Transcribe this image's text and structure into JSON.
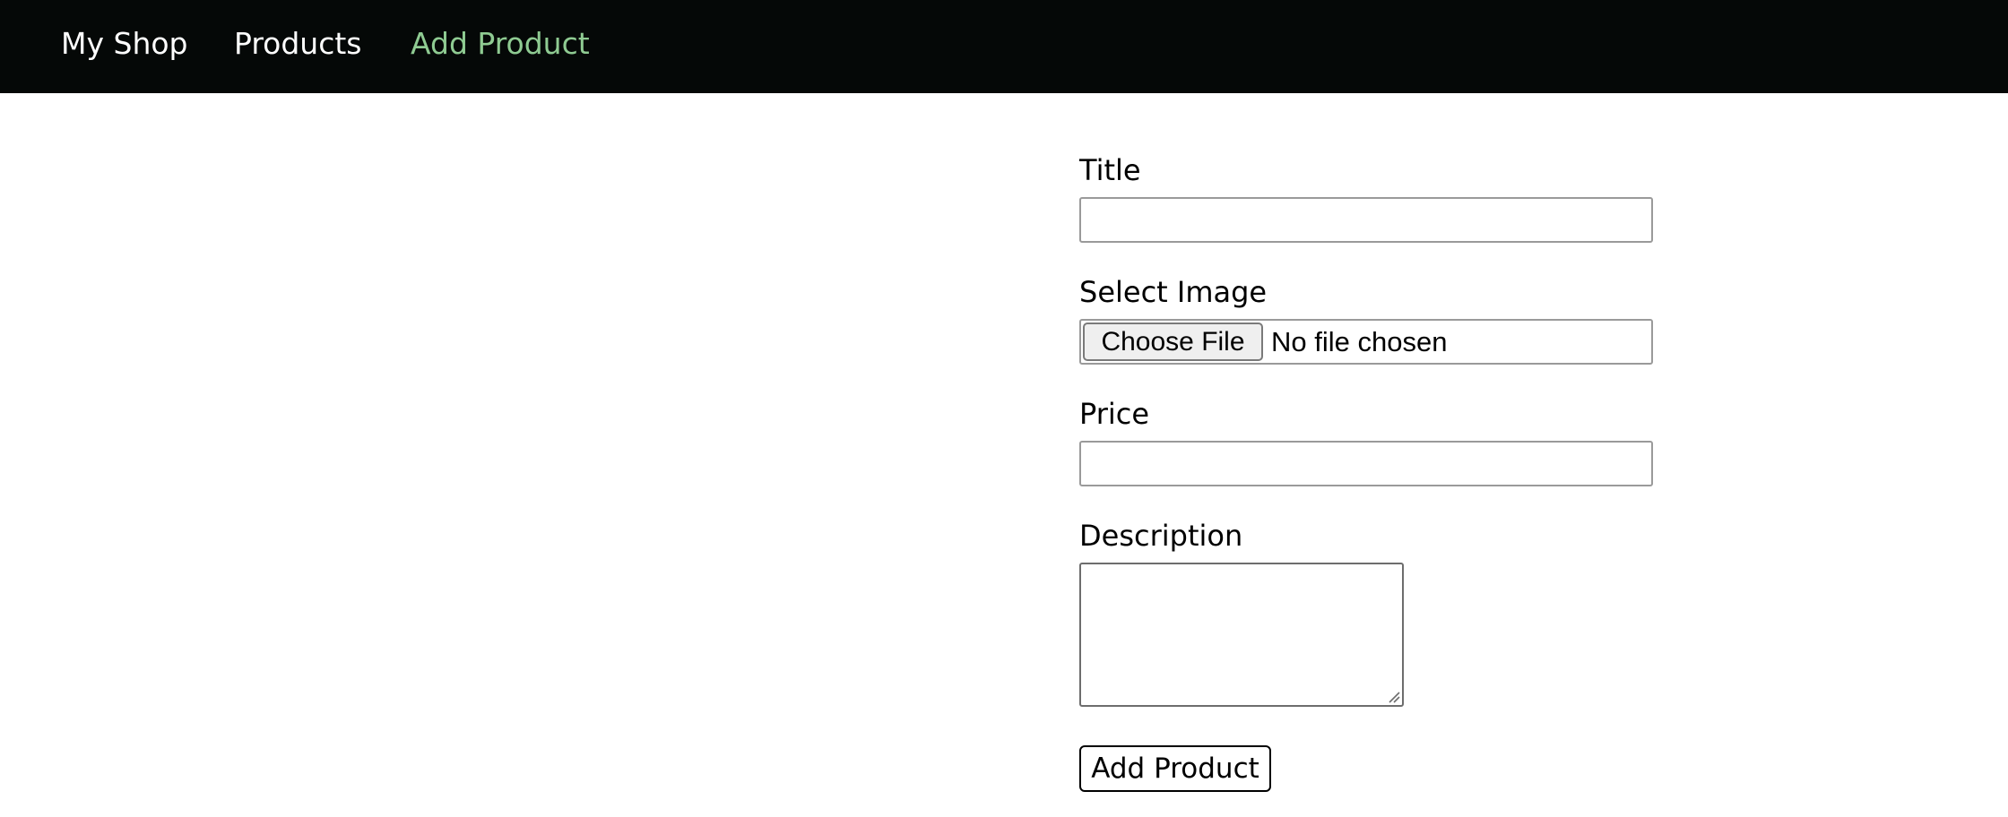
{
  "colors": {
    "nav_background": "#050807",
    "nav_text": "#ffffff",
    "nav_active_text": "#8fcb92"
  },
  "nav": {
    "brand": "My Shop",
    "items": [
      {
        "label": "Products",
        "active": false
      },
      {
        "label": "Add Product",
        "active": true
      }
    ]
  },
  "form": {
    "title": {
      "label": "Title",
      "value": ""
    },
    "image": {
      "label": "Select Image",
      "button_label": "Choose File",
      "status": "No file chosen"
    },
    "price": {
      "label": "Price",
      "value": ""
    },
    "description": {
      "label": "Description",
      "value": ""
    },
    "submit_label": "Add Product"
  }
}
